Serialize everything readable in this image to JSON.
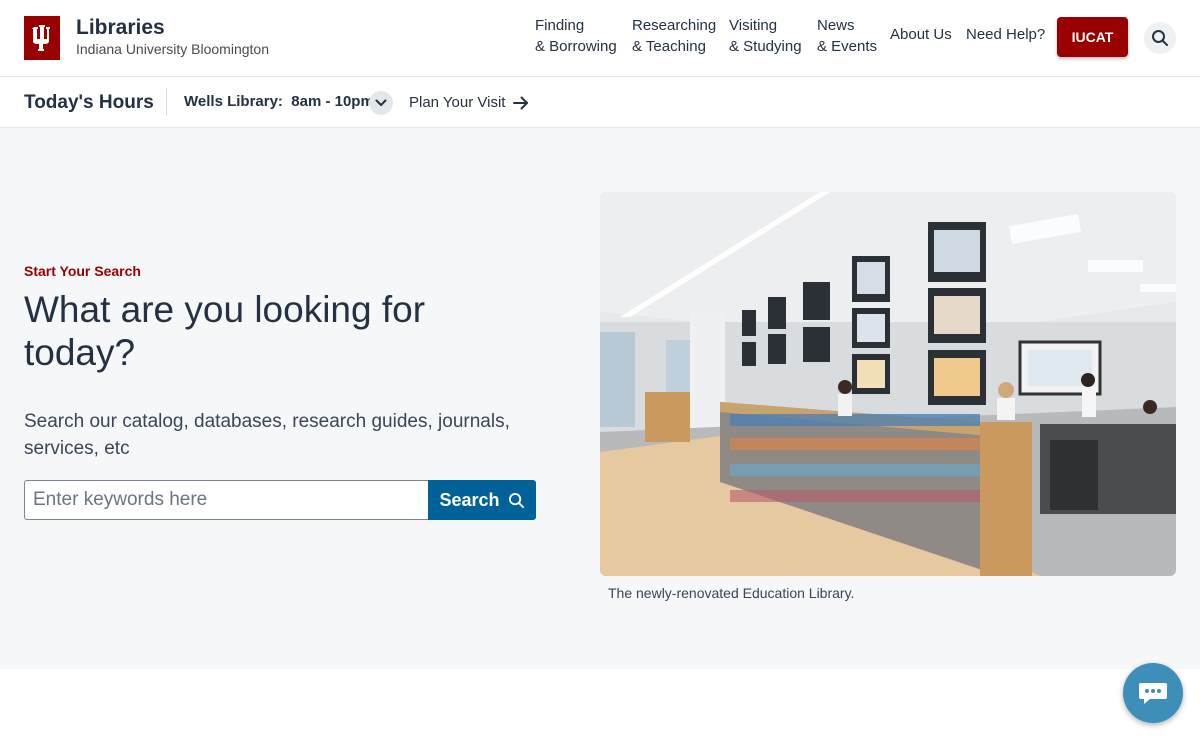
{
  "header": {
    "brand_title": "Libraries",
    "brand_subtitle": "Indiana University Bloomington",
    "logo_icon": "iu-trident-icon",
    "brand_color": "#990000",
    "nav": [
      {
        "line1": "Finding",
        "line2": "& Borrowing"
      },
      {
        "line1": "Researching",
        "line2": "& Teaching"
      },
      {
        "line1": "Visiting",
        "line2": "& Studying"
      },
      {
        "line1": "News",
        "line2": "& Events"
      }
    ],
    "about": "About Us",
    "help": "Need Help?",
    "iucat": "IUCAT",
    "search_icon": "search-icon"
  },
  "hours": {
    "title": "Today's Hours",
    "library": "Wells Library:",
    "time": "8am - 10pm",
    "plan_visit": "Plan Your Visit"
  },
  "hero": {
    "eyebrow": "Start Your Search",
    "heading": "What are you looking for today?",
    "description": "Search our catalog, databases, research guides, journals, services, etc",
    "search_placeholder": "Enter keywords here",
    "search_button": "Search",
    "caption": "The newly-renovated Education Library.",
    "accent_color": "#006298"
  },
  "chat": {
    "icon": "chat-bubble-icon"
  }
}
